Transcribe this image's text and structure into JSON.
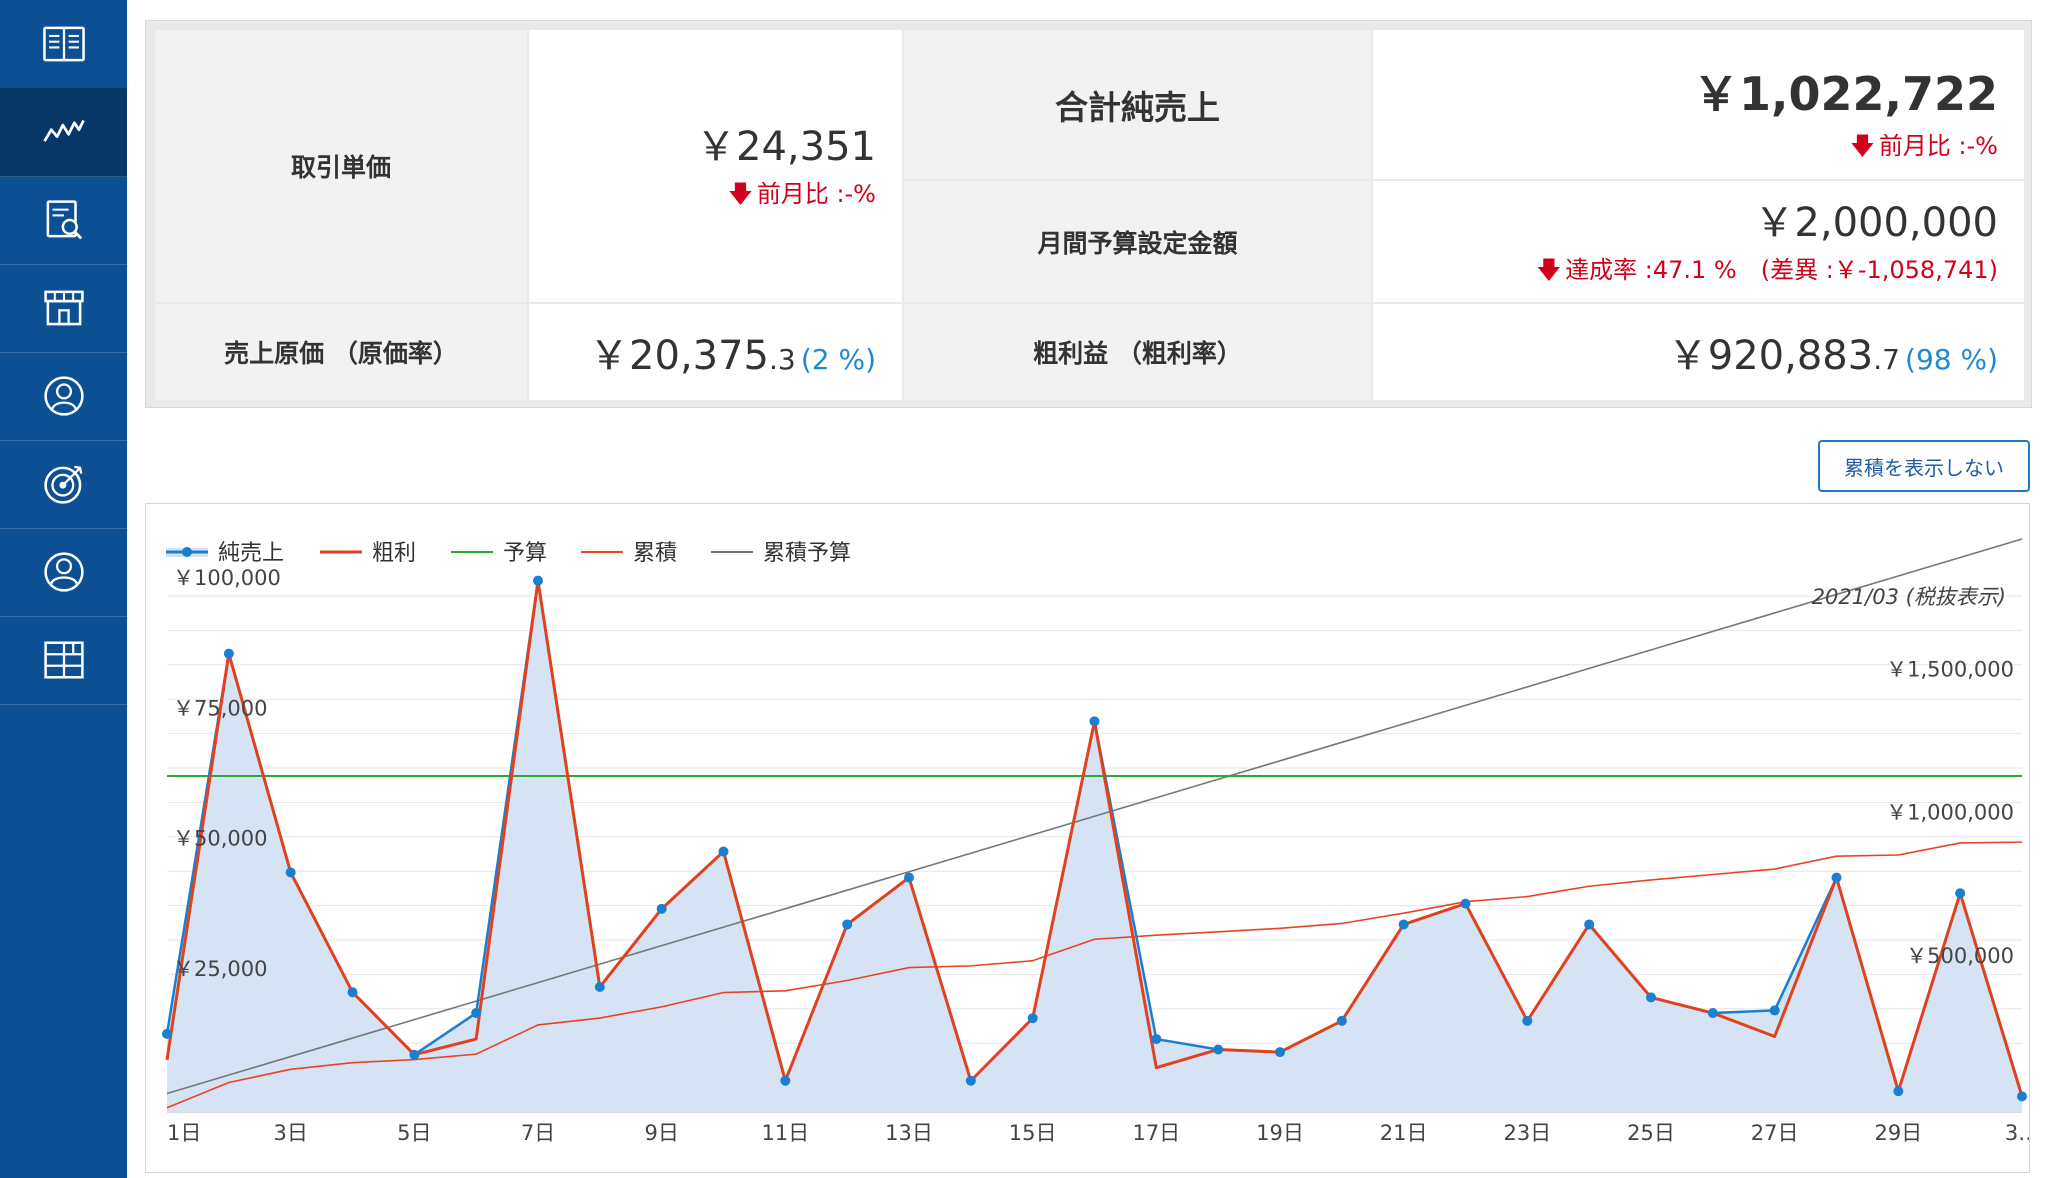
{
  "sidebar": {
    "items": [
      {
        "icon": "book-icon",
        "active": false
      },
      {
        "icon": "line-chart-icon",
        "active": true
      },
      {
        "icon": "report-search-icon",
        "active": false
      },
      {
        "icon": "store-icon",
        "active": false
      },
      {
        "icon": "user-badge-icon",
        "active": false
      },
      {
        "icon": "target-icon",
        "active": false
      },
      {
        "icon": "user-icon",
        "active": false
      },
      {
        "icon": "grid-icon",
        "active": false
      }
    ]
  },
  "summary": {
    "unit_price": {
      "label": "取引単価",
      "currency": "￥",
      "value": "24,351",
      "change": "前月比 :-%"
    },
    "net_sales": {
      "label": "合計純売上",
      "currency": "￥",
      "value": "1,022,722",
      "change": "前月比 :-%"
    },
    "budget": {
      "label": "月間予算設定金額",
      "currency": "￥",
      "value": "2,000,000",
      "change": "達成率 :47.1 %　(差異 :￥-1,058,741)"
    },
    "cost": {
      "label": "売上原価 （原価率）",
      "currency": "￥",
      "value": "20,375",
      "decimal": ".3",
      "rate": "(2 %)"
    },
    "gross": {
      "label": "粗利益 （粗利率）",
      "currency": "￥",
      "value": "920,883",
      "decimal": ".7",
      "rate": "(98 %)"
    }
  },
  "toggle_button": "累積を表示しない",
  "colors": {
    "sidebar": "#0d4f93",
    "sidebar_active": "#073766",
    "net_sales": "#1a7fd1",
    "net_sales_fill": "#d5e3f4",
    "gross": "#e0421d",
    "budget": "#2ea82e",
    "cumulative": "#e94322",
    "cumulative_budget": "#777777",
    "negative": "#d0021b",
    "rate": "#1e88d4"
  },
  "chart_data": {
    "type": "line",
    "annotation": "2021/03 (税抜表示)",
    "legend": [
      "純売上",
      "粗利",
      "予算",
      "累積",
      "累積予算"
    ],
    "legend_placement": "top-left",
    "grid": true,
    "x_tick_labels": [
      "1日",
      "3日",
      "5日",
      "7日",
      "9日",
      "11日",
      "13日",
      "15日",
      "17日",
      "19日",
      "21日",
      "23日",
      "25日",
      "27日",
      "29日",
      "3…"
    ],
    "x": [
      1,
      2,
      3,
      4,
      5,
      6,
      7,
      8,
      9,
      10,
      11,
      12,
      13,
      14,
      15,
      16,
      17,
      18,
      19,
      20,
      21,
      22,
      23,
      24,
      25,
      26,
      27,
      28,
      29,
      30,
      31
    ],
    "left_axis": {
      "ylim": [
        0,
        110000
      ],
      "ticks": [
        25000,
        50000,
        75000,
        100000
      ],
      "tick_labels": [
        "￥25,000",
        "￥50,000",
        "￥75,000",
        "￥100,000"
      ]
    },
    "right_axis": {
      "ylim": [
        0,
        2000000
      ],
      "ticks": [
        500000,
        1000000,
        1500000
      ],
      "tick_labels": [
        "￥500,000",
        "￥1,000,000",
        "￥1,500,000"
      ]
    },
    "series": [
      {
        "name": "純売上",
        "axis": "left",
        "values": [
          15000,
          88000,
          46000,
          23000,
          11000,
          19000,
          102000,
          24000,
          39000,
          50000,
          6000,
          36000,
          45000,
          6000,
          18000,
          75000,
          14000,
          12000,
          11500,
          17500,
          36000,
          40000,
          17500,
          36000,
          22000,
          19000,
          19500,
          45000,
          4000,
          42000,
          3000
        ]
      },
      {
        "name": "粗利",
        "axis": "left",
        "values": [
          10000,
          88000,
          46000,
          23000,
          11000,
          14000,
          102000,
          24000,
          39000,
          50000,
          6000,
          36000,
          45000,
          6000,
          18000,
          75000,
          8500,
          12000,
          11500,
          17500,
          36000,
          40000,
          17500,
          36000,
          22000,
          19000,
          14500,
          45000,
          4000,
          42000,
          3000
        ]
      },
      {
        "name": "予算",
        "axis": "left",
        "values": [
          64500,
          64500,
          64500,
          64500,
          64500,
          64500,
          64500,
          64500,
          64500,
          64500,
          64500,
          64500,
          64500,
          64500,
          64500,
          64500,
          64500,
          64500,
          64500,
          64500,
          64500,
          64500,
          64500,
          64500,
          64500,
          64500,
          64500,
          64500,
          64500,
          64500,
          64500
        ]
      },
      {
        "name": "累積",
        "axis": "right",
        "values": [
          15000,
          103000,
          149000,
          172000,
          183000,
          202000,
          304000,
          328000,
          367000,
          417000,
          423000,
          459000,
          504000,
          510000,
          528000,
          603000,
          617000,
          629000,
          641000,
          658000,
          694000,
          734000,
          752000,
          788000,
          810000,
          829000,
          848000,
          893000,
          897000,
          939000,
          942000
        ]
      },
      {
        "name": "累積予算",
        "axis": "right",
        "values": [
          64516,
          129032,
          193548,
          258065,
          322581,
          387097,
          451613,
          516129,
          580645,
          645161,
          709677,
          774194,
          838710,
          903226,
          967742,
          1032258,
          1096774,
          1161290,
          1225806,
          1290323,
          1354839,
          1419355,
          1483871,
          1548387,
          1612903,
          1677419,
          1741935,
          1806452,
          1870968,
          1935484,
          2000000
        ]
      }
    ]
  }
}
